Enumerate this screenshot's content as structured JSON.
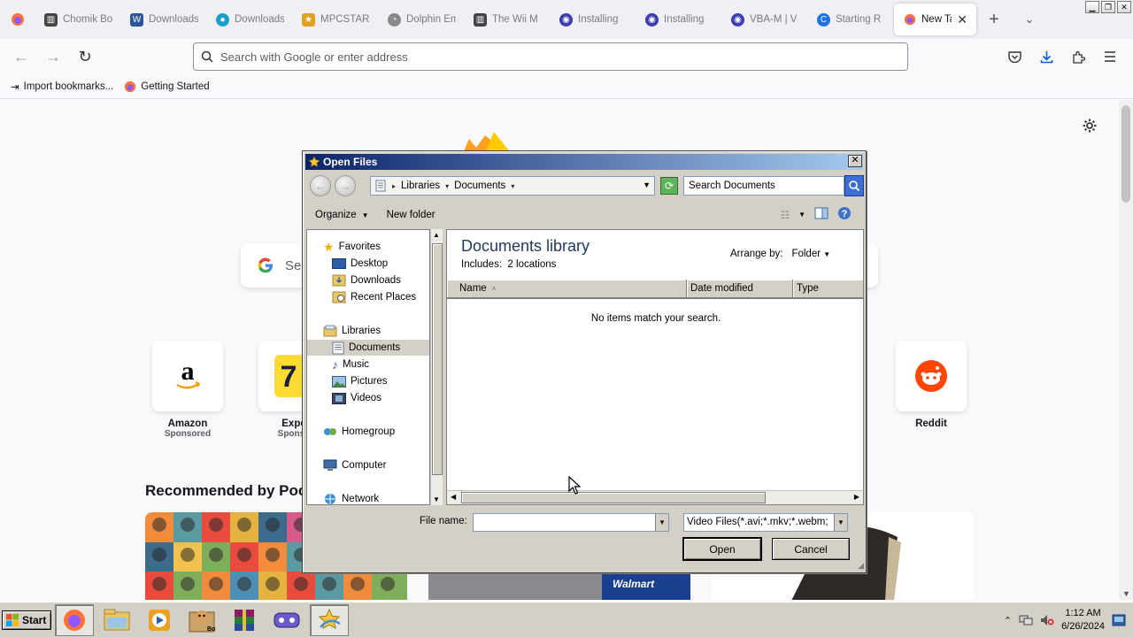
{
  "browser": {
    "tabs": [
      {
        "label": "Chomik Bo",
        "fav_color": "#444444",
        "fav_glyph": "▥"
      },
      {
        "label": "Downloads",
        "fav_color": "#2b579a",
        "fav_glyph": "W"
      },
      {
        "label": "Downloads",
        "fav_color": "#1a9fc9",
        "fav_glyph": "●"
      },
      {
        "label": "MPCSTAR",
        "fav_color": "#e0a020",
        "fav_glyph": "★"
      },
      {
        "label": "Dolphin Em",
        "fav_color": "#888888",
        "fav_glyph": "◔"
      },
      {
        "label": "The Wii M",
        "fav_color": "#444444",
        "fav_glyph": "▥"
      },
      {
        "label": "Installing",
        "fav_color": "#3b3bb0",
        "fav_glyph": "◉"
      },
      {
        "label": "Installing",
        "fav_color": "#3b3bb0",
        "fav_glyph": "◉"
      },
      {
        "label": "VBA-M | V",
        "fav_color": "#3b3bb0",
        "fav_glyph": "◉"
      },
      {
        "label": "Starting R",
        "fav_color": "#1a73e8",
        "fav_glyph": "C"
      }
    ],
    "active_tab": {
      "label": "New Tab"
    },
    "url_placeholder": "Search with Google or enter address",
    "bookmarks": [
      {
        "label": "Import bookmarks..."
      },
      {
        "label": "Getting Started"
      }
    ]
  },
  "newtab": {
    "search_placeholder_visible": "Se",
    "shortcuts": [
      {
        "name": "Amazon",
        "sub": "Sponsored"
      },
      {
        "name": "Expe",
        "sub": "Sponso"
      },
      {
        "name": "Reddit",
        "sub": ""
      }
    ],
    "recommended_heading": "Recommended by Pock",
    "pocket_tag": "Walmart"
  },
  "dialog": {
    "title": "Open Files",
    "breadcrumb": [
      "Libraries",
      "Documents"
    ],
    "search_placeholder": "Search Documents",
    "organize_label": "Organize",
    "new_folder_label": "New folder",
    "nav_tree": {
      "favorites": "Favorites",
      "desktop": "Desktop",
      "downloads": "Downloads",
      "recent": "Recent Places",
      "libraries": "Libraries",
      "documents": "Documents",
      "music": "Music",
      "pictures": "Pictures",
      "videos": "Videos",
      "homegroup": "Homegroup",
      "computer": "Computer",
      "network": "Network"
    },
    "library_title": "Documents library",
    "includes_label": "Includes:",
    "includes_value": "2 locations",
    "arrange_by_label": "Arrange by:",
    "arrange_by_value": "Folder",
    "columns": [
      "Name",
      "Date modified",
      "Type"
    ],
    "empty_message": "No items match your search.",
    "file_name_label": "File name:",
    "file_name_value": "",
    "file_type_value": "Video Files(*.avi;*.mkv;*.webm;",
    "open_label": "Open",
    "cancel_label": "Cancel"
  },
  "taskbar": {
    "start_label": "Start",
    "time": "1:12 AM",
    "date": "6/26/2024"
  }
}
